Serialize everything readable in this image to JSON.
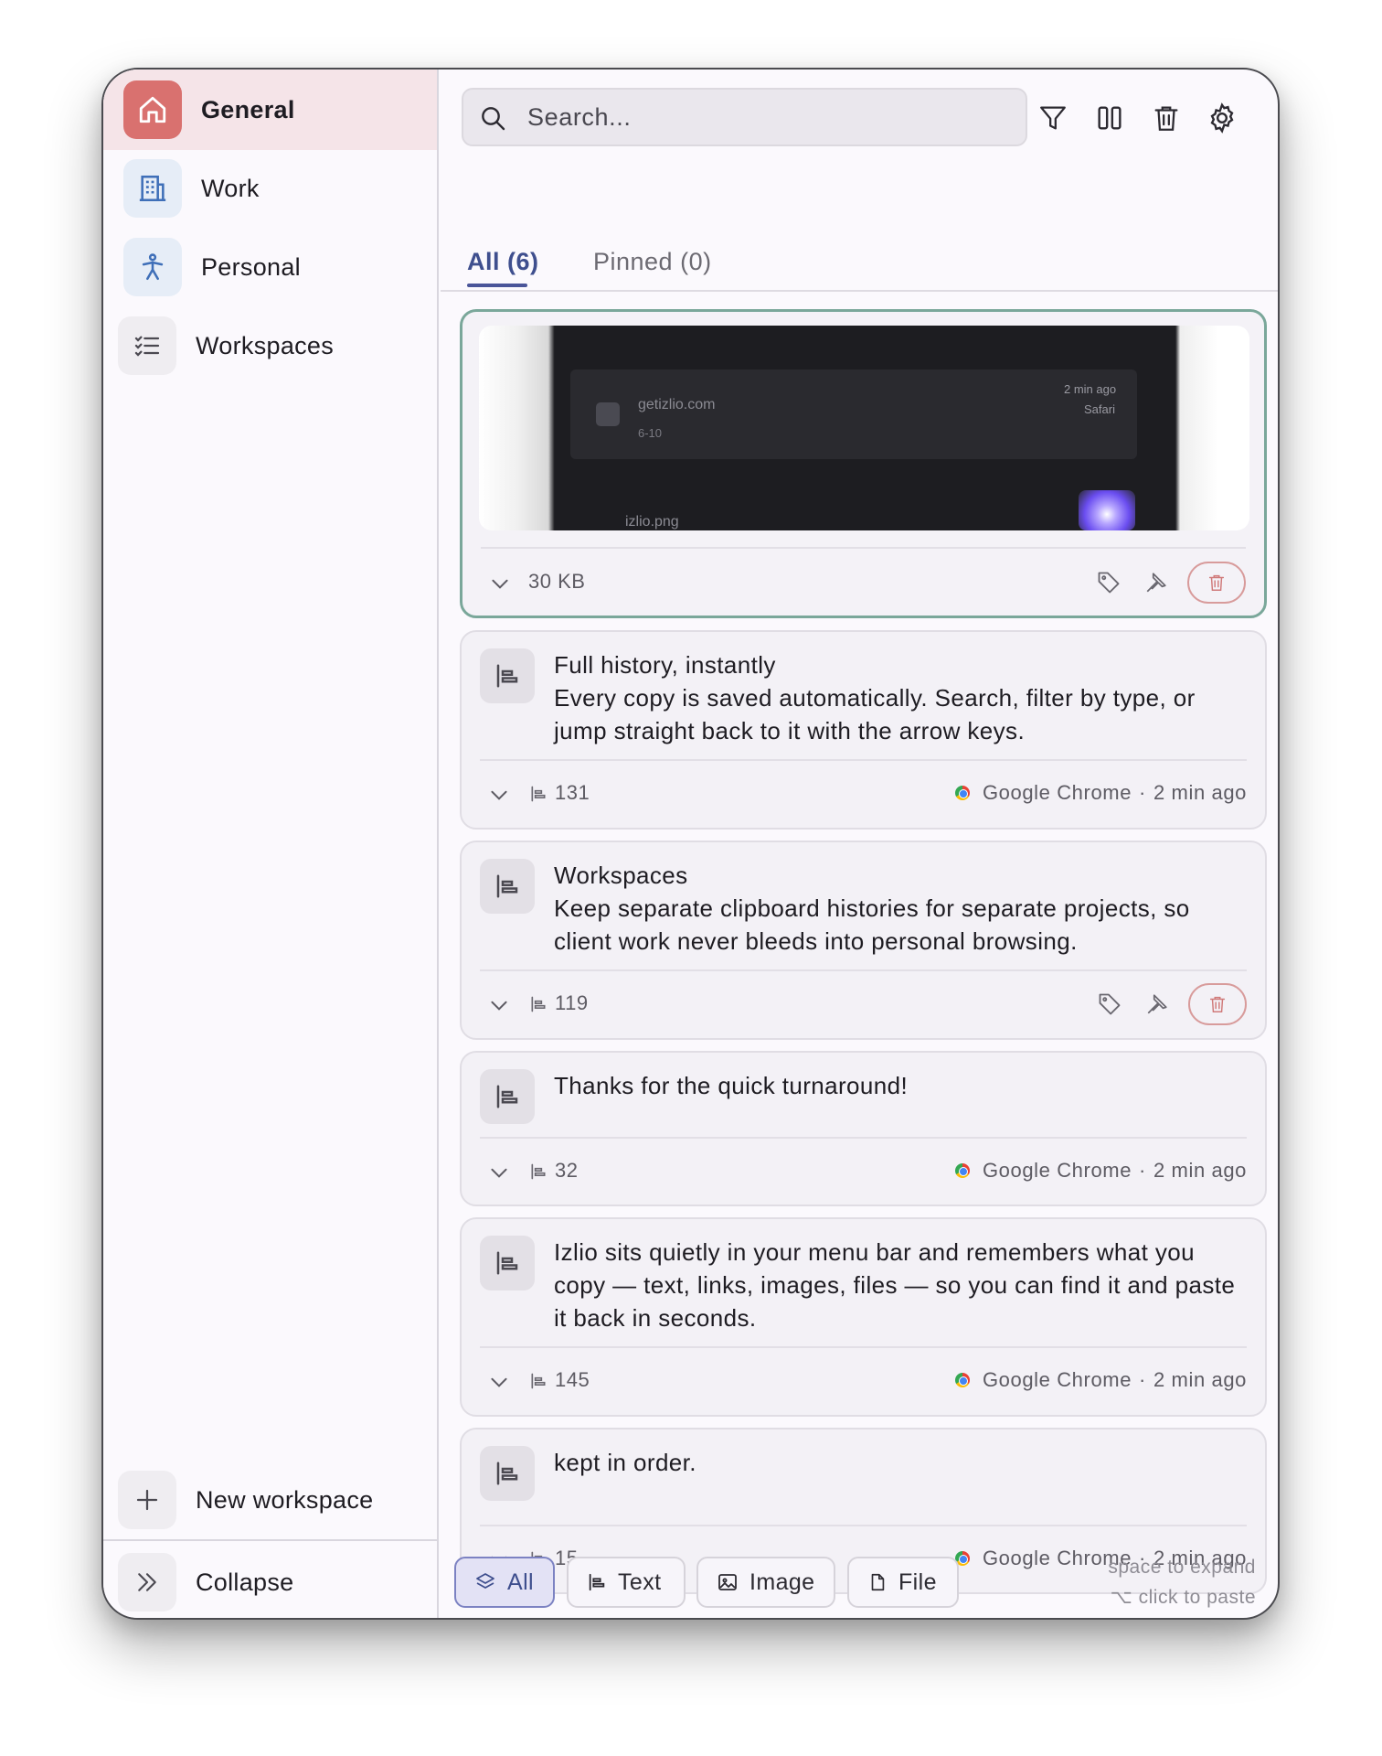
{
  "sidebar": {
    "workspaces": [
      {
        "label": "General",
        "icon": "home-icon",
        "active": true
      },
      {
        "label": "Work",
        "icon": "building-icon",
        "active": false
      },
      {
        "label": "Personal",
        "icon": "person-icon",
        "active": false
      },
      {
        "label": "Workspaces",
        "icon": "checklist-icon",
        "active": false
      }
    ],
    "new_workspace_label": "New workspace",
    "collapse_label": "Collapse"
  },
  "search": {
    "placeholder": "Search..."
  },
  "toolbar": {
    "icons": [
      "filter-icon",
      "columns-icon",
      "trash-icon",
      "gear-icon"
    ]
  },
  "tabs": [
    {
      "label": "All (6)",
      "active": true
    },
    {
      "label": "Pinned (0)",
      "active": false
    }
  ],
  "items": [
    {
      "type": "image",
      "size": "30 KB",
      "preview_text": {
        "domain": "getizlio.com",
        "sub": "6-10",
        "time": "2 min ago",
        "src": "Safari",
        "file": "izlio.png"
      }
    },
    {
      "type": "text",
      "lines": [
        "Full history, instantly",
        "Every copy is saved automatically. Search, filter by type, or jump straight back to it with the arrow keys."
      ],
      "count": "131",
      "source": "Google Chrome",
      "time": "2 min ago"
    },
    {
      "type": "text",
      "lines": [
        "Workspaces",
        "Keep separate clipboard histories for separate projects, so client work never bleeds into personal browsing."
      ],
      "count": "119"
    },
    {
      "type": "text",
      "lines": [
        "Thanks for the quick turnaround!"
      ],
      "count": "32",
      "source": "Google Chrome",
      "time": "2 min ago"
    },
    {
      "type": "text",
      "lines": [
        "Izlio sits quietly in your menu bar and remembers what you copy — text, links, images, files — so you can find it and paste it back in seconds."
      ],
      "count": "145",
      "source": "Google Chrome",
      "time": "2 min ago"
    },
    {
      "type": "text",
      "lines": [
        "kept in order."
      ],
      "count": "15",
      "source": "Google Chrome",
      "time": "2 min ago"
    }
  ],
  "separator": "·",
  "filters": [
    {
      "label": "All",
      "icon": "layers-icon",
      "active": true
    },
    {
      "label": "Text",
      "icon": "text-align-icon",
      "active": false
    },
    {
      "label": "Image",
      "icon": "image-icon",
      "active": false
    },
    {
      "label": "File",
      "icon": "file-icon",
      "active": false
    }
  ],
  "hints": [
    "space to expand",
    "⌥ click to paste"
  ],
  "colors": {
    "accent": "#4a5599",
    "active_workspace": "#d9716f",
    "selected_border": "#7aa79a",
    "delete": "#d89b9b"
  }
}
